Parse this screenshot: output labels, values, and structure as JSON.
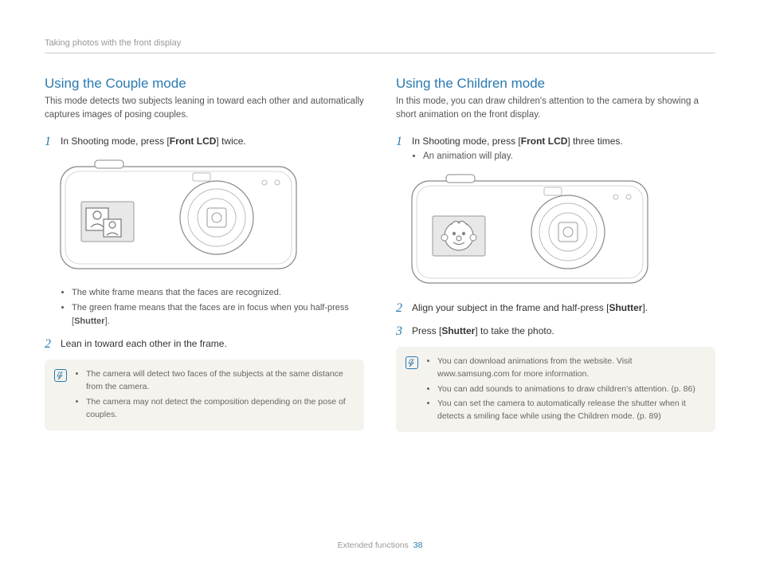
{
  "header": {
    "breadcrumb": "Taking photos with the front display"
  },
  "left": {
    "title": "Using the Couple mode",
    "intro": "This mode detects two subjects leaning in toward each other and automatically captures images of posing couples.",
    "step1": {
      "num": "1",
      "pre": "In Shooting mode, press [",
      "btn": "Front LCD",
      "post": "] twice."
    },
    "step1_bullets": [
      "The white frame means that the faces are recognized.",
      "The green frame means that the faces are in focus when you half-press [Shutter]."
    ],
    "step2": {
      "num": "2",
      "text": "Lean in toward each other in the frame."
    },
    "notes": [
      "The camera will detect two faces of the subjects at the same distance from the camera.",
      "The camera may not detect the composition depending on the pose of couples."
    ]
  },
  "right": {
    "title": "Using the Children mode",
    "intro": "In this mode, you can draw children's attention to the camera by showing a short animation on the front display.",
    "step1": {
      "num": "1",
      "pre": "In Shooting mode, press [",
      "btn": "Front LCD",
      "post": "] three times."
    },
    "step1_sub": "An animation will play.",
    "step2": {
      "num": "2",
      "pre": "Align your subject in the frame and half-press [",
      "btn": "Shutter",
      "post": "]."
    },
    "step3": {
      "num": "3",
      "pre": "Press [",
      "btn": "Shutter",
      "post": "] to take the photo."
    },
    "notes": [
      "You can download animations from the website. Visit www.samsung.com for more information.",
      "You can add sounds to animations to draw children's attention. (p. 86)",
      "You can set the camera to automatically release the shutter when it detects a smiling face while using the Children mode. (p. 89)"
    ]
  },
  "footer": {
    "section": "Extended functions",
    "page": "38"
  }
}
